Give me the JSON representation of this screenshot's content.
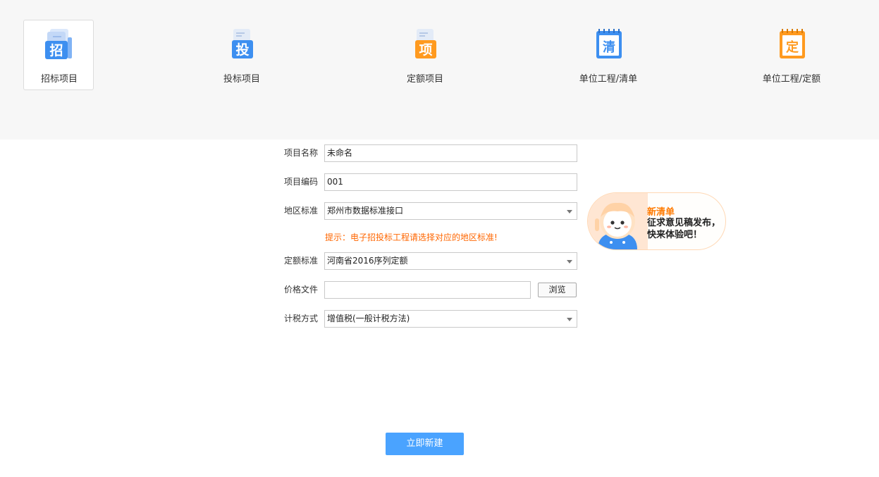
{
  "project_types": [
    {
      "label": "招标项目",
      "glyph": "招",
      "color": "#3d8ff0",
      "selected": true
    },
    {
      "label": "投标项目",
      "glyph": "投",
      "color": "#3d8ff0",
      "selected": false
    },
    {
      "label": "定额项目",
      "glyph": "项",
      "color": "#ff9a1f",
      "selected": false
    },
    {
      "label": "单位工程/清单",
      "glyph": "清",
      "color": "#3d8ff0",
      "selected": false
    },
    {
      "label": "单位工程/定额",
      "glyph": "定",
      "color": "#ff9a1f",
      "selected": false
    }
  ],
  "form": {
    "project_name": {
      "label": "项目名称",
      "value": "未命名"
    },
    "project_code": {
      "label": "项目编码",
      "value": "001"
    },
    "region_standard": {
      "label": "地区标准",
      "value": "郑州市数据标准接口"
    },
    "hint": "提示：电子招投标工程请选择对应的地区标准!",
    "quota_standard": {
      "label": "定额标准",
      "value": "河南省2016序列定额"
    },
    "price_file": {
      "label": "价格文件",
      "value": "",
      "browse_label": "浏览"
    },
    "tax_method": {
      "label": "计税方式",
      "value": "增值税(一般计税方法)"
    }
  },
  "promo": {
    "title": "新清单",
    "text_line1": "征求意见稿发布，",
    "text_line2": "快来体验吧！"
  },
  "submit_label": "立即新建",
  "colors": {
    "accent": "#4aa3ff",
    "hint": "#ff6600",
    "promo_title": "#ff7a00"
  }
}
